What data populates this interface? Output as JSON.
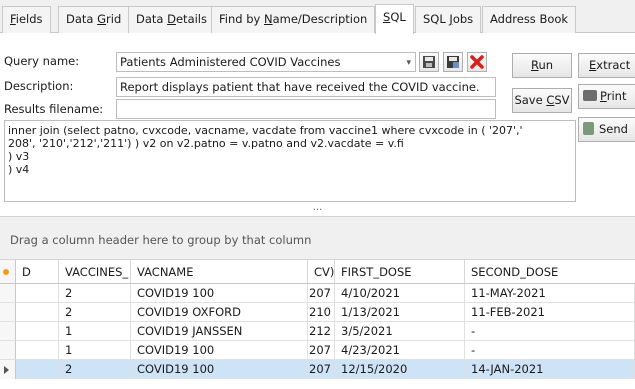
{
  "tabs": [
    {
      "label": "Fields",
      "u": "F",
      "rest": "ields"
    },
    {
      "label": "Data Grid",
      "pre": "Data ",
      "u": "G",
      "rest": "rid"
    },
    {
      "label": "Data Details",
      "pre": "Data ",
      "u": "D",
      "rest": "etails"
    },
    {
      "label": "Find by Name/Description",
      "pre": "Find by ",
      "u": "N",
      "rest": "ame/Description"
    },
    {
      "label": "SQL",
      "u": "S",
      "rest": "QL"
    },
    {
      "label": "SQL Jobs",
      "pre": "SQL ",
      "u": "J",
      "rest": "obs"
    },
    {
      "label": "Address Book"
    }
  ],
  "form": {
    "query_name_label": "Query name:",
    "query_name_value": "Patients Administered COVID Vaccines",
    "description_label": "Description:",
    "description_value": "Report displays patient that have received the COVID vaccine.",
    "results_label": "Results filename:",
    "results_value": ""
  },
  "buttons": {
    "run": {
      "u": "R",
      "rest": "un"
    },
    "save_csv": {
      "pre": "Save ",
      "u": "C",
      "rest": "SV"
    },
    "extract": {
      "u": "E",
      "rest": "xtract"
    },
    "print": {
      "u": "P",
      "rest": "rint"
    },
    "send": "Send"
  },
  "sql_text": "inner join (select patno, cvxcode, vacname, vacdate from vaccine1 where cvxcode in ( '207','\n208', '210','212','211') ) v2 on v2.patno = v.patno and v2.vacdate = v.fi\n) v3\n) v4",
  "splitter_glyph": "...",
  "group_panel_text": "Drag a column header here to group by that column",
  "grid": {
    "columns": [
      "D",
      "VACCINES_",
      "VACNAME",
      "CV)",
      "FIRST_DOSE",
      "SECOND_DOSE"
    ],
    "rows": [
      [
        "2",
        "COVID19 100",
        "207",
        "4/10/2021",
        "11-MAY-2021"
      ],
      [
        "2",
        "COVID19 OXFORD",
        "210",
        "1/13/2021",
        "11-FEB-2021"
      ],
      [
        "1",
        "COVID19 JANSSEN",
        "212",
        "3/5/2021",
        "-"
      ],
      [
        "1",
        "COVID19 100",
        "207",
        "4/23/2021",
        "-"
      ],
      [
        "2",
        "COVID19 100",
        "207",
        "12/15/2020",
        "14-JAN-2021"
      ]
    ]
  },
  "colors": {
    "accent": "#cfe3f7",
    "delete_red": "#d42020",
    "indicator_orange": "#f39c12"
  }
}
